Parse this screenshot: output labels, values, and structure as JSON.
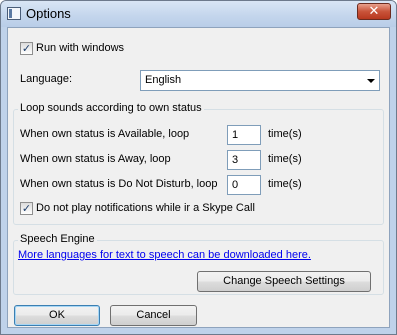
{
  "window": {
    "title": "Options",
    "close_glyph": "✕"
  },
  "general": {
    "run_with_windows": {
      "label": "Run with windows",
      "checked": true,
      "mark": "✓"
    },
    "language_label": "Language:",
    "language_value": "English"
  },
  "loop_group": {
    "title": "Loop sounds according to own status",
    "rows": [
      {
        "label": "When own status is Available, loop",
        "value": "1",
        "unit": "time(s)"
      },
      {
        "label": "When own status is Away, loop",
        "value": "3",
        "unit": "time(s)"
      },
      {
        "label": "When own status is Do Not Disturb, loop",
        "value": "0",
        "unit": "time(s)"
      }
    ],
    "skype_call": {
      "label": "Do not play notifications while ir a Skype Call",
      "checked": true,
      "mark": "✓"
    }
  },
  "speech_group": {
    "title": "Speech Engine",
    "link": "More languages for text to speech can be downloaded here.",
    "settings_button": "Change Speech Settings"
  },
  "footer": {
    "ok": "OK",
    "cancel": "Cancel"
  },
  "colors": {
    "link": "#0000ee",
    "close_button": "#c9543a",
    "title_bar": "#c3d5ec"
  }
}
